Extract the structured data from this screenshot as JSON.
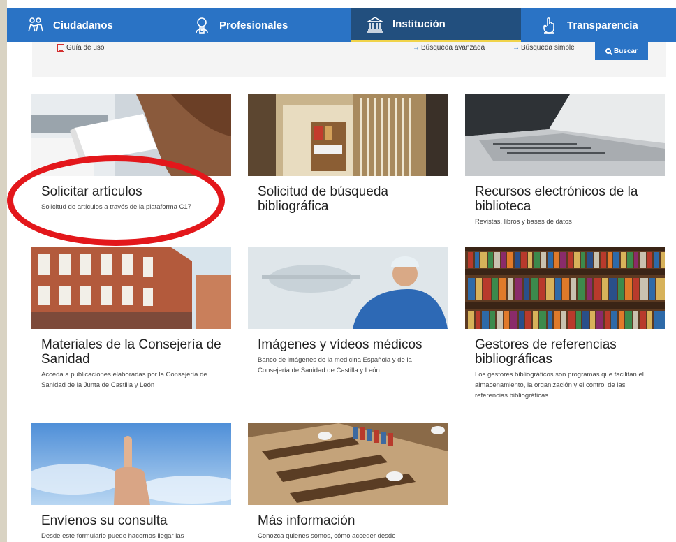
{
  "nav": {
    "items": [
      {
        "label": "Ciudadanos",
        "icon": "people-icon"
      },
      {
        "label": "Profesionales",
        "icon": "doctor-icon"
      },
      {
        "label": "Institución",
        "icon": "institution-icon"
      },
      {
        "label": "Transparencia",
        "icon": "hand-icon"
      }
    ],
    "active": "Institución"
  },
  "search": {
    "guide_label": "Guía de uso",
    "advanced_label": "Búsqueda avanzada",
    "simple_label": "Búsqueda simple",
    "button_label": "Buscar"
  },
  "cards": [
    {
      "title": "Solicitar artículos",
      "desc": "Solicitud de artículos a través de la plataforma C17"
    },
    {
      "title": "Solicitud de búsqueda bibliográfica",
      "desc": ""
    },
    {
      "title": "Recursos electrónicos de la biblioteca",
      "desc": "Revistas, libros y bases de datos"
    },
    {
      "title": "Materiales de la Consejería de Sanidad",
      "desc": "Acceda a publicaciones elaboradas por la Consejería de Sanidad de la Junta de Castilla y León"
    },
    {
      "title": "Imágenes y vídeos médicos",
      "desc": "Banco de imágenes de la medicina Española y de la Consejería de Sanidad de Castilla y León"
    },
    {
      "title": "Gestores de referencias bibliográficas",
      "desc": "Los gestores bibliográficos son programas que facilitan el almacenamiento, la organización y el control de las referencias bibliográficas"
    },
    {
      "title": "Envíenos su consulta",
      "desc": "Desde este formulario puede hacernos llegar las"
    },
    {
      "title": "Más información",
      "desc": "Conozca quienes somos, cómo acceder desde"
    }
  ],
  "colors": {
    "nav_bg": "#2a73c5",
    "nav_active_bg": "#224f7e",
    "nav_active_underline": "#f0d34a",
    "highlight_ellipse": "#e3171b"
  }
}
